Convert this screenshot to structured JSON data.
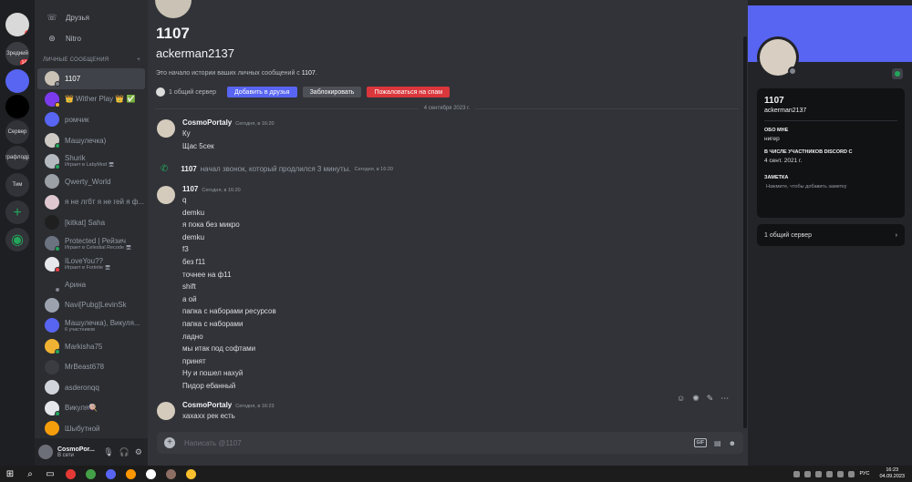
{
  "rail": {
    "servers": [
      {
        "label": "",
        "badge": "1",
        "color": "#d9d9d9"
      },
      {
        "label": "Зредиий",
        "badge": "147",
        "color": "#3a3c42"
      },
      {
        "label": "",
        "badge": "",
        "color": "#5865f2"
      },
      {
        "label": "",
        "badge": "",
        "color": "#000000"
      },
      {
        "label": "Сервер",
        "badge": "",
        "color": "#313338"
      },
      {
        "label": "графлодр",
        "badge": "",
        "color": "#313338"
      },
      {
        "label": "Тим",
        "badge": "",
        "color": "#313338"
      }
    ],
    "add_icon": "+",
    "explore_icon": "◉"
  },
  "nav": {
    "friends": "Друзья",
    "nitro": "Nitro"
  },
  "dm_header": {
    "title": "ЛИЧНЫЕ СООБЩЕНИЯ",
    "add": "+"
  },
  "dms": [
    {
      "name": "1107",
      "sub": "",
      "color": "#c9c2b5",
      "status": "#80848e",
      "active": true
    },
    {
      "name": "👑 Wither Play 👑 ✅",
      "sub": "",
      "color": "#7c3aed",
      "status": "#f0b232",
      "active": false
    },
    {
      "name": "ромчик",
      "sub": "",
      "color": "#5865f2",
      "status": "",
      "active": false
    },
    {
      "name": "Машулечка)",
      "sub": "",
      "color": "#cfc9c4",
      "status": "#23a55a",
      "active": false
    },
    {
      "name": "Shurik",
      "sub": "Играет в LabyMod 🖥",
      "color": "#b5bac1",
      "status": "#23a55a",
      "active": false
    },
    {
      "name": "Qwerty_World",
      "sub": "",
      "color": "#9aa0a6",
      "status": "",
      "active": false
    },
    {
      "name": "я не лгбт я не гей я ф...",
      "sub": "",
      "color": "#e0c8d0",
      "status": "",
      "active": false
    },
    {
      "name": "[kitkat] Saha",
      "sub": "",
      "color": "#1f1f1f",
      "status": "",
      "active": false
    },
    {
      "name": "Protected | Рейзич",
      "sub": "Играет в Celestial Recode 🖥",
      "color": "#6b7280",
      "status": "#23a55a",
      "active": false
    },
    {
      "name": "ILoveYou??",
      "sub": "Играет в Fortnite 🖥",
      "color": "#e5e7eb",
      "status": "#f23f42",
      "active": false
    },
    {
      "name": "Арина",
      "sub": "",
      "color": "#2b2d31",
      "status": "#80848e",
      "active": false
    },
    {
      "name": "Navi[Pubg]LevinSk",
      "sub": "",
      "color": "#9ca3af",
      "status": "",
      "active": false
    },
    {
      "name": "Машулечка), Викуля...",
      "sub": "6 участников",
      "color": "#5865f2",
      "status": "",
      "active": false
    },
    {
      "name": "Markisha75",
      "sub": "",
      "color": "#f0b232",
      "status": "#23a55a",
      "active": false
    },
    {
      "name": "MrBeast678",
      "sub": "",
      "color": "#3a3c42",
      "status": "",
      "active": false
    },
    {
      "name": "asderonqq",
      "sub": "",
      "color": "#d1d5db",
      "status": "",
      "active": false
    },
    {
      "name": "Викуля🍭",
      "sub": "",
      "color": "#e5e7eb",
      "status": "#23a55a",
      "active": false
    },
    {
      "name": "Шыбутной",
      "sub": "",
      "color": "#f59e0b",
      "status": "",
      "active": false
    }
  ],
  "user": {
    "name": "CosmoPor...",
    "status": "В сети"
  },
  "chat": {
    "title": "1107",
    "username": "ackerman2137",
    "intro_prefix": "Это начало истории ваших личных сообщений с ",
    "intro_name": "1107",
    "intro_suffix": ".",
    "mutual": "1 общий сервер",
    "btn_add": "Добавить в друзья",
    "btn_block": "Заблокировать",
    "btn_spam": "Пожаловаться на спам",
    "date_divider": "4 сентября 2023 г.",
    "groups": [
      {
        "author": "CosmoPortaly",
        "time": "Сегодня, в 16:20",
        "lines": [
          "Ку",
          "Щас 5сек"
        ]
      },
      {
        "author": "1107",
        "time": "Сегодня, в 16:20",
        "lines": [
          "q",
          "demku",
          "я пока без микро",
          "demku",
          "f3",
          "без f11",
          "точнее на ф11",
          "shift",
          "а ой",
          "папка с наборами ресурсов",
          "папка с наборами",
          "ладно",
          "мы итак под софтами",
          "принят",
          "Ну и пошел нахуй",
          "Пидор ебанный"
        ]
      },
      {
        "author": "CosmoPortaly",
        "time": "Сегодня, в 16:23",
        "lines": [
          "хахахх рек есть"
        ]
      }
    ],
    "call": {
      "name": "1107",
      "text": "начал звонок, который продлился 3 минуты.",
      "time": "Сегодня, в 16:20"
    },
    "composer_placeholder": "Написать @1107"
  },
  "profile": {
    "name": "1107",
    "username": "ackerman2137",
    "about_label": "ОБО МНЕ",
    "about": "нигер",
    "member_label": "В ЧИСЛЕ УЧАСТНИКОВ DISCORD С",
    "member_since": "4 сент. 2021 г.",
    "note_label": "ЗАМЕТКА",
    "note_placeholder": "Нажмите, чтобы добавить заметку",
    "mutual": "1 общий сервер",
    "banner_color": "#5865f2"
  },
  "taskbar": {
    "apps": [
      {
        "icon": "windows-start-icon",
        "color": "#ffffff",
        "glyph": "⊞"
      },
      {
        "icon": "search-icon",
        "color": "#ffffff",
        "glyph": "⌕"
      },
      {
        "icon": "task-view-icon",
        "color": "#ffffff",
        "glyph": "▭"
      },
      {
        "icon": "yandex-icon",
        "color": "#e53935",
        "glyph": ""
      },
      {
        "icon": "utorrent-icon",
        "color": "#43a047",
        "glyph": ""
      },
      {
        "icon": "discord-icon",
        "color": "#5865f2",
        "glyph": ""
      },
      {
        "icon": "browser-icon",
        "color": "#ff9800",
        "glyph": ""
      },
      {
        "icon": "yandex-browser-icon",
        "color": "#ffffff",
        "glyph": ""
      },
      {
        "icon": "package-icon",
        "color": "#8d6e63",
        "glyph": ""
      },
      {
        "icon": "explorer-icon",
        "color": "#fbc02d",
        "glyph": ""
      }
    ],
    "lang": "РУС",
    "time": "16:23",
    "date": "04.09.2023"
  }
}
